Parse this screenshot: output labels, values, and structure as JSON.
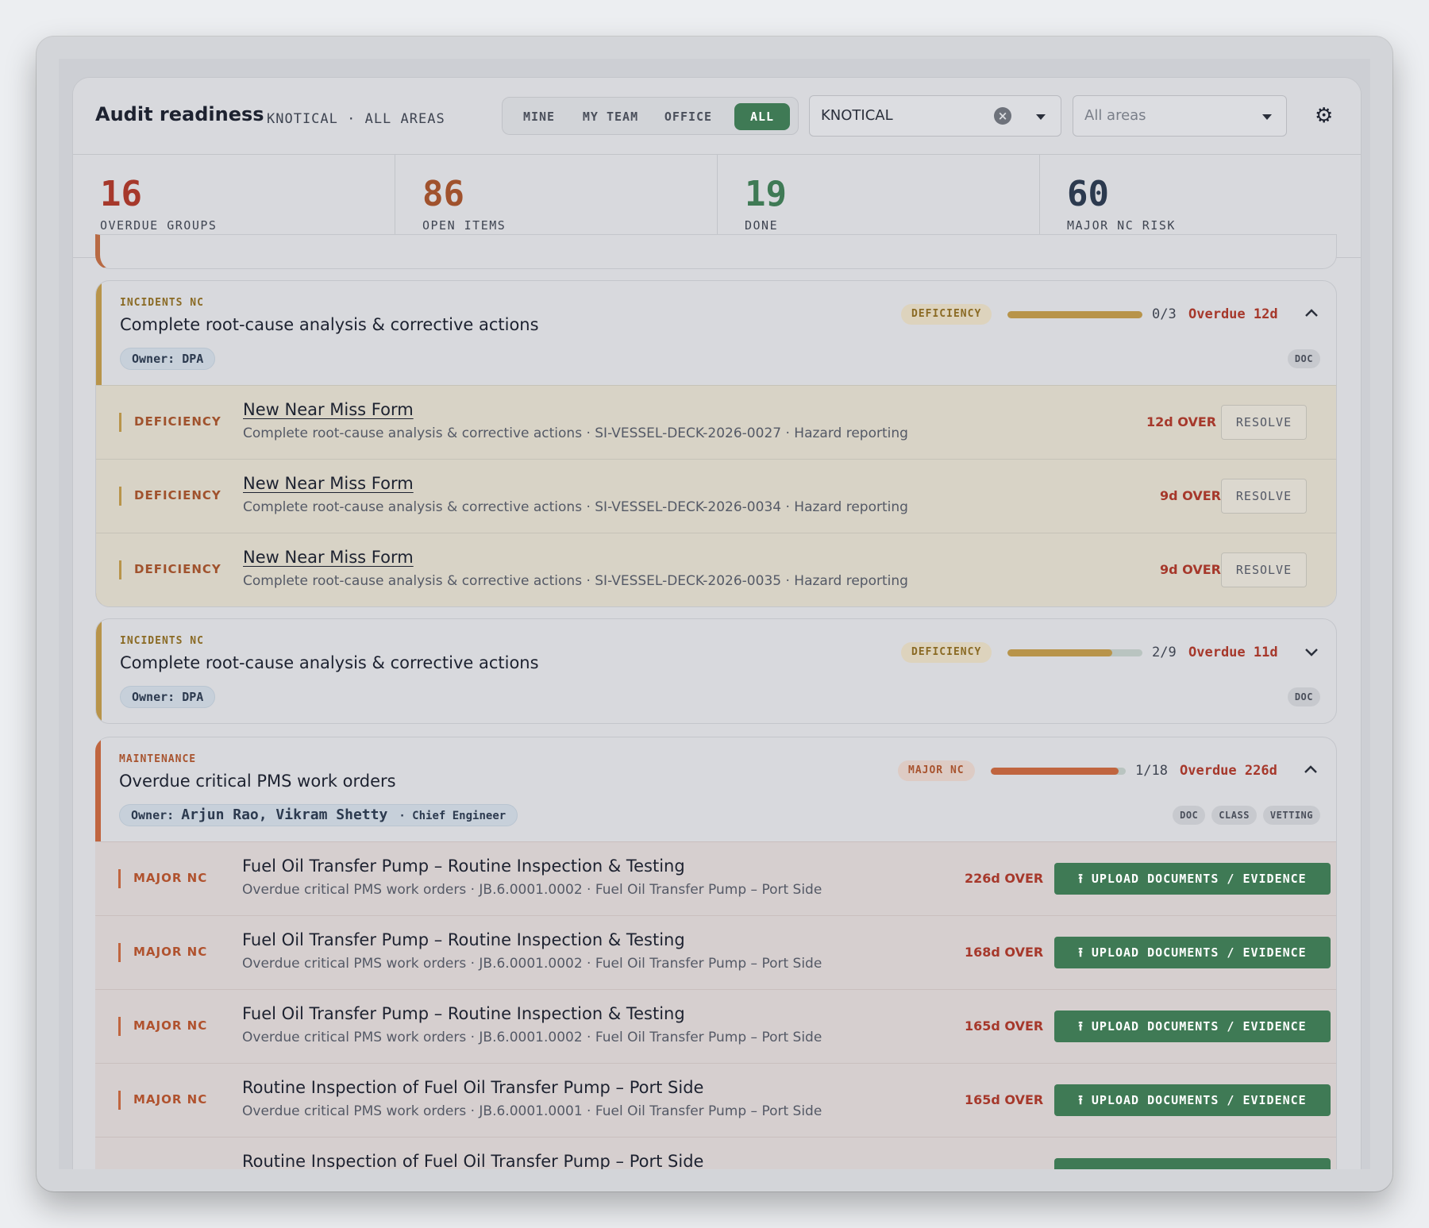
{
  "header": {
    "title": "Audit readiness",
    "subtitle": "KNOTICAL · ALL AREAS",
    "scope_tabs": [
      {
        "label": "MINE",
        "active": false
      },
      {
        "label": "MY TEAM",
        "active": false
      },
      {
        "label": "OFFICE",
        "active": false
      },
      {
        "label": "ALL",
        "active": true
      }
    ],
    "vessel_select": {
      "value": "KNOTICAL"
    },
    "area_select": {
      "placeholder": "All areas"
    },
    "settings_icon": "gear-icon"
  },
  "stats": [
    {
      "value": "16",
      "label": "OVERDUE GROUPS",
      "color": "#a6382b"
    },
    {
      "value": "86",
      "label": "OPEN ITEMS",
      "color": "#a0522d"
    },
    {
      "value": "19",
      "label": "DONE",
      "color": "#3f7a55"
    },
    {
      "value": "60",
      "label": "MAJOR NC RISK",
      "color": "#2c3a4f"
    }
  ],
  "groups": [
    {
      "category": "INCIDENTS NC",
      "title": "Complete root-cause analysis & corrective actions",
      "owner": "Owner: DPA",
      "severity": "DEFICIENCY",
      "progress_done": 0,
      "progress_total": 3,
      "progress_text": "0/3",
      "overdue": "Overdue 12d",
      "expanded": true,
      "tags": [
        "DOC"
      ],
      "items": [
        {
          "severity": "DEFICIENCY",
          "title": "New Near Miss Form",
          "subtitle": "Complete root-cause analysis & corrective actions · SI-VESSEL-DECK-2026-0027 · Hazard reporting",
          "over": "12d OVER",
          "action": "RESOLVE"
        },
        {
          "severity": "DEFICIENCY",
          "title": "New Near Miss Form",
          "subtitle": "Complete root-cause analysis & corrective actions · SI-VESSEL-DECK-2026-0034 · Hazard reporting",
          "over": "9d OVER",
          "action": "RESOLVE"
        },
        {
          "severity": "DEFICIENCY",
          "title": "New Near Miss Form",
          "subtitle": "Complete root-cause analysis & corrective actions · SI-VESSEL-DECK-2026-0035 · Hazard reporting",
          "over": "9d OVER",
          "action": "RESOLVE"
        }
      ]
    },
    {
      "category": "INCIDENTS NC",
      "title": "Complete root-cause analysis & corrective actions",
      "owner": "Owner: DPA",
      "severity": "DEFICIENCY",
      "progress_done": 2,
      "progress_total": 9,
      "progress_text": "2/9",
      "overdue": "Overdue 11d",
      "expanded": false,
      "tags": [
        "DOC"
      ]
    },
    {
      "category": "MAINTENANCE",
      "title": "Overdue critical PMS work orders",
      "owner_prefix": "Owner: ",
      "owner_names": "Arjun Rao, Vikram Shetty",
      "owner_role": "· Chief Engineer",
      "severity": "MAJOR NC",
      "progress_done": 1,
      "progress_total": 18,
      "progress_text": "1/18",
      "overdue": "Overdue 226d",
      "expanded": true,
      "tags": [
        "DOC",
        "CLASS",
        "VETTING"
      ],
      "items": [
        {
          "severity": "MAJOR NC",
          "title": "Fuel Oil Transfer Pump – Routine Inspection & Testing",
          "subtitle": "Overdue critical PMS work orders · JB.6.0001.0002 · Fuel Oil Transfer Pump – Port Side",
          "over": "226d OVER",
          "action": "UPLOAD DOCUMENTS / EVIDENCE"
        },
        {
          "severity": "MAJOR NC",
          "title": "Fuel Oil Transfer Pump – Routine Inspection & Testing",
          "subtitle": "Overdue critical PMS work orders · JB.6.0001.0002 · Fuel Oil Transfer Pump – Port Side",
          "over": "168d OVER",
          "action": "UPLOAD DOCUMENTS / EVIDENCE"
        },
        {
          "severity": "MAJOR NC",
          "title": "Fuel Oil Transfer Pump – Routine Inspection & Testing",
          "subtitle": "Overdue critical PMS work orders · JB.6.0001.0002 · Fuel Oil Transfer Pump – Port Side",
          "over": "165d OVER",
          "action": "UPLOAD DOCUMENTS / EVIDENCE"
        },
        {
          "severity": "MAJOR NC",
          "title": "Routine Inspection of Fuel Oil Transfer Pump – Port Side",
          "subtitle": "Overdue critical PMS work orders · JB.6.0001.0001 · Fuel Oil Transfer Pump – Port Side",
          "over": "165d OVER",
          "action": "UPLOAD DOCUMENTS / EVIDENCE"
        },
        {
          "severity": "",
          "title": "Routine Inspection of Fuel Oil Transfer Pump – Port Side",
          "subtitle": "",
          "over": "",
          "action": ""
        }
      ]
    }
  ],
  "colors": {
    "accent_green": "#3f7a55",
    "deficiency": "#b8944a",
    "major_nc": "#c0653f",
    "overdue_red": "#a6382b"
  }
}
